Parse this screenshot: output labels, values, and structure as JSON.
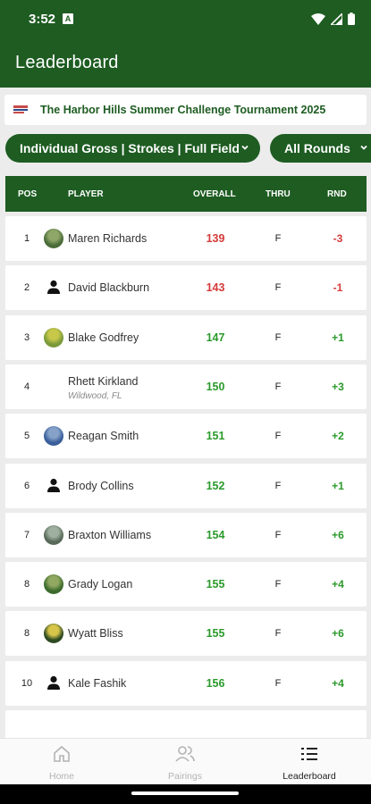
{
  "status": {
    "time": "3:52",
    "notif_glyph": "A"
  },
  "appbar": {
    "title": "Leaderboard"
  },
  "banner": {
    "text": "The Harbor Hills Summer Challenge Tournament 2025"
  },
  "filters": {
    "field_label": "Individual Gross | Strokes | Full Field",
    "rounds_label": "All Rounds"
  },
  "table": {
    "headers": {
      "pos": "POS",
      "player": "PLAYER",
      "overall": "OVERALL",
      "thru": "THRU",
      "rnd": "RND"
    },
    "rows": [
      {
        "pos": "1",
        "name": "Maren Richards",
        "location": "",
        "overall": "139",
        "overall_color": "#d63a3a",
        "thru": "F",
        "rnd": "-3",
        "rnd_color": "#d63a3a",
        "avatar": "photo"
      },
      {
        "pos": "2",
        "name": "David Blackburn",
        "location": "",
        "overall": "143",
        "overall_color": "#d63a3a",
        "thru": "F",
        "rnd": "-1",
        "rnd_color": "#d63a3a",
        "avatar": "person-icon"
      },
      {
        "pos": "3",
        "name": "Blake Godfrey",
        "location": "",
        "overall": "147",
        "overall_color": "#2b9a2b",
        "thru": "F",
        "rnd": "+1",
        "rnd_color": "#2b9a2b",
        "avatar": "photo"
      },
      {
        "pos": "4",
        "name": "Rhett Kirkland",
        "location": "Wildwood, FL",
        "overall": "150",
        "overall_color": "#2b9a2b",
        "thru": "F",
        "rnd": "+3",
        "rnd_color": "#2b9a2b",
        "avatar": "none"
      },
      {
        "pos": "5",
        "name": "Reagan Smith",
        "location": "",
        "overall": "151",
        "overall_color": "#2b9a2b",
        "thru": "F",
        "rnd": "+2",
        "rnd_color": "#2b9a2b",
        "avatar": "photo"
      },
      {
        "pos": "6",
        "name": "Brody Collins",
        "location": "",
        "overall": "152",
        "overall_color": "#2b9a2b",
        "thru": "F",
        "rnd": "+1",
        "rnd_color": "#2b9a2b",
        "avatar": "person-icon"
      },
      {
        "pos": "7",
        "name": "Braxton Williams",
        "location": "",
        "overall": "154",
        "overall_color": "#2b9a2b",
        "thru": "F",
        "rnd": "+6",
        "rnd_color": "#2b9a2b",
        "avatar": "photo"
      },
      {
        "pos": "8",
        "name": "Grady Logan",
        "location": "",
        "overall": "155",
        "overall_color": "#2b9a2b",
        "thru": "F",
        "rnd": "+4",
        "rnd_color": "#2b9a2b",
        "avatar": "photo"
      },
      {
        "pos": "8",
        "name": "Wyatt Bliss",
        "location": "",
        "overall": "155",
        "overall_color": "#2b9a2b",
        "thru": "F",
        "rnd": "+6",
        "rnd_color": "#2b9a2b",
        "avatar": "photo"
      },
      {
        "pos": "10",
        "name": "Kale Fashik",
        "location": "",
        "overall": "156",
        "overall_color": "#2b9a2b",
        "thru": "F",
        "rnd": "+4",
        "rnd_color": "#2b9a2b",
        "avatar": "person-icon"
      }
    ]
  },
  "bottom_nav": {
    "home": "Home",
    "pairings": "Pairings",
    "leaderboard": "Leaderboard"
  },
  "colors": {
    "brand_green": "#1e5c22",
    "under_par_red": "#d63a3a",
    "over_par_green": "#2b9a2b"
  }
}
